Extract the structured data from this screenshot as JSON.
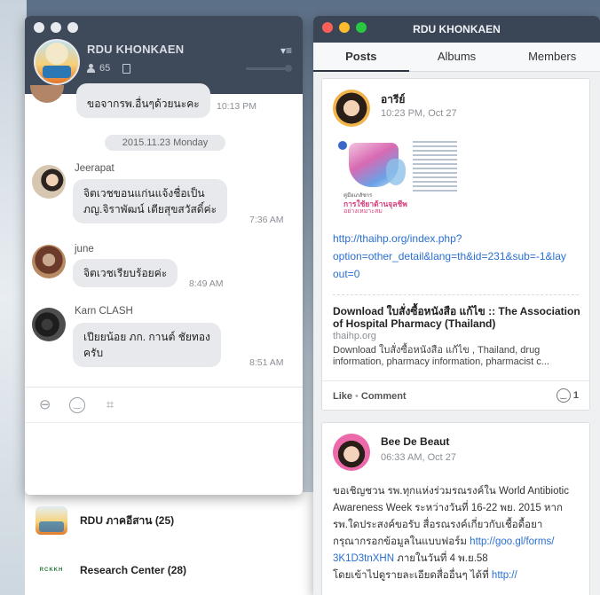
{
  "chat": {
    "group_name": "RDU KHONKAEN",
    "member_count": "65",
    "messages": [
      {
        "text": "ขอจากรพ.อื่นๆด้วยนะคะ",
        "time": "10:13 PM"
      },
      {
        "sender": "Jeerapat",
        "lines": [
          "จิตเวชขอนแก่นแจ้งชื่อเป็น",
          "ภญ.จิราพัฒน์ เตียสุขสวัสดิ์ค่ะ"
        ],
        "time": "7:36 AM"
      },
      {
        "sender": "june",
        "text": "จิตเวชเรียบร้อยค่ะ",
        "time": "8:49 AM"
      },
      {
        "sender": "Karn CLASH",
        "lines": [
          "เปียยน้อย ภก. กานต์ ชัยทอง",
          "ครับ"
        ],
        "time": "8:51 AM"
      }
    ],
    "date_divider": "2015.11.23 Monday"
  },
  "group_list": [
    {
      "name": "RDU ภาคอีสาน (25)"
    },
    {
      "name": "Research Center (28)",
      "logo_text": "RCKKH"
    }
  ],
  "posts_window": {
    "title": "RDU KHONKAEN",
    "tabs": [
      "Posts",
      "Albums",
      "Members"
    ],
    "active_tab": "Posts"
  },
  "posts": [
    {
      "author": "อารีย์",
      "time": "10:23 PM, Oct 27",
      "thumb_caption_small": "คู่มือเภสัชกร",
      "thumb_caption_main": "การใช้ยาต้านจุลชีพ",
      "thumb_caption_sub": "อย่างเหมาะสม",
      "link_lines": [
        "http://thaihp.org/index.php?",
        "option=other_detail&lang=th&id=231&sub=-1&lay",
        "out=0"
      ],
      "preview_title": "Download ใบสั่งซื้อหนังสือ แก้ไข :: The Association of Hospital Pharmacy (Thailand)",
      "preview_host": "thaihp.org",
      "preview_desc": "Download ใบสั่งซื้อหนังสือ แก้ไข , Thailand, drug information, pharmacy information, pharmacist c...",
      "like_label": "Like",
      "comment_label": "Comment",
      "reaction_count": "1"
    },
    {
      "author": "Bee De Beaut",
      "time": "06:33 AM, Oct 27",
      "body_l1": "ขอเชิญชวน รพ.ทุกแห่งร่วมรณรงค์ใน World Antibiotic",
      "body_l2": "Awareness Week ระหว่างวันที่ 16-22 พย. 2015 หาก",
      "body_l3": "รพ.ใดประสงค์ขอรับ สื่อรณรงค์เกี่ยวกับเชื้อดื้อยา",
      "body_l4": "กรุณากรอกข้อมูลในแบบฟอร์ม ",
      "body_link1a": "http://goo.gl/forms/",
      "body_link1b": "3K1D3tnXHN",
      "body_l5": " ภายในวันที่ 4 พ.ย.58",
      "body_l6": "โดยเข้าไปดูรายละเอียดสื่ออื่นๆ ได้ที่ ",
      "body_link2": "http://"
    }
  ],
  "colors": {
    "header_dark": "#3e4a5a",
    "link_blue": "#2a6fd1",
    "bubble_gray": "#e7e9ec"
  }
}
